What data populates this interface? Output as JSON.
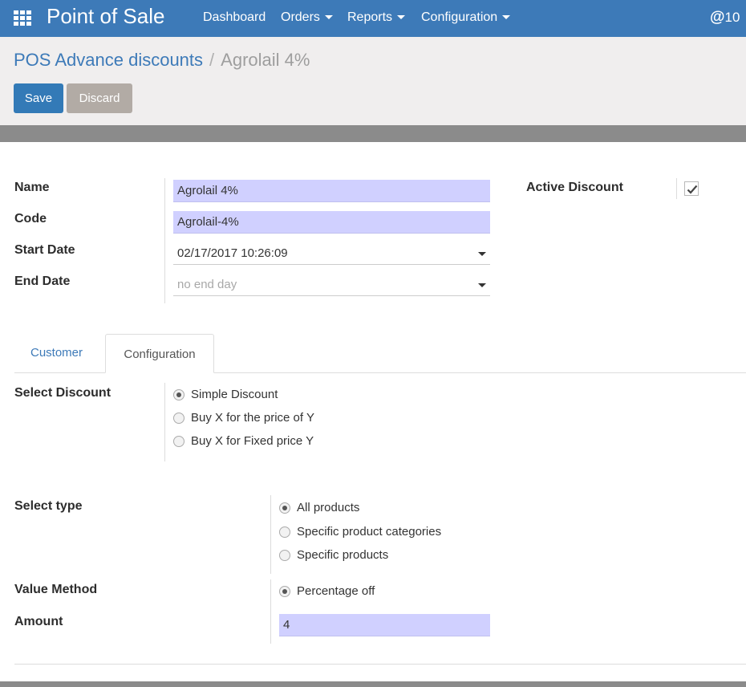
{
  "topbar": {
    "app_title": "Point of Sale",
    "menu": [
      {
        "label": "Dashboard",
        "dropdown": false
      },
      {
        "label": "Orders",
        "dropdown": true
      },
      {
        "label": "Reports",
        "dropdown": true
      },
      {
        "label": "Configuration",
        "dropdown": true
      }
    ],
    "right_text": "10",
    "right_icon": "@"
  },
  "breadcrumb": {
    "parent": "POS Advance discounts",
    "separator": "/",
    "current": "Agrolail 4%"
  },
  "buttons": {
    "save": "Save",
    "discard": "Discard"
  },
  "form": {
    "name": {
      "label": "Name",
      "value": "Agrolail 4%"
    },
    "code": {
      "label": "Code",
      "value": "Agrolail-4%"
    },
    "start_date": {
      "label": "Start Date",
      "value": "02/17/2017 10:26:09"
    },
    "end_date": {
      "label": "End Date",
      "value": "",
      "placeholder": "no end day"
    },
    "active_discount": {
      "label": "Active Discount",
      "checked": true
    }
  },
  "tabs": {
    "customer": "Customer",
    "configuration": "Configuration",
    "active": "configuration"
  },
  "config": {
    "select_discount": {
      "label": "Select Discount",
      "options": [
        "Simple Discount",
        "Buy X for the price of Y",
        "Buy X for Fixed price Y"
      ],
      "selected": 0
    },
    "select_type": {
      "label": "Select type",
      "options": [
        "All products",
        "Specific product categories",
        "Specific products"
      ],
      "selected": 0
    },
    "value_method": {
      "label": "Value Method",
      "options": [
        "Percentage off"
      ],
      "selected": 0
    },
    "amount": {
      "label": "Amount",
      "value": "4"
    }
  },
  "colors": {
    "topbar": "#3d7ab8",
    "save_button": "#337ab7",
    "discard_button": "#b2aba5",
    "required_field": "#d0d0ff",
    "control_panel": "#f0eeee"
  }
}
